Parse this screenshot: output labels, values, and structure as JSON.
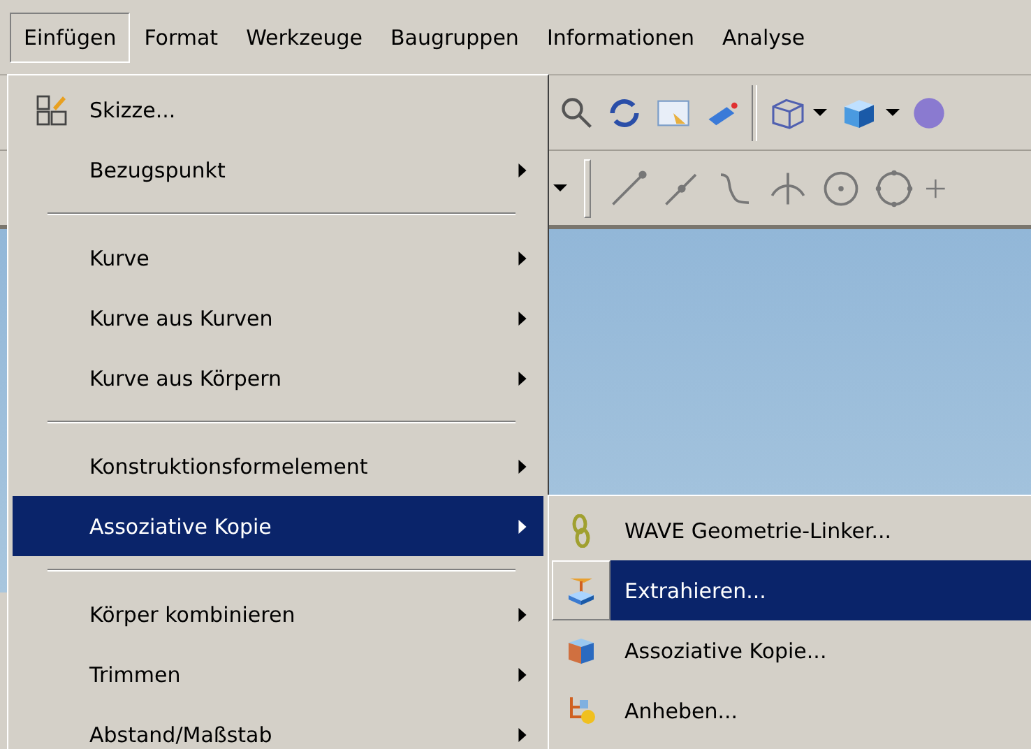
{
  "menu_bar": [
    {
      "label": "Einfügen",
      "selected": true
    },
    {
      "label": "Format",
      "selected": false
    },
    {
      "label": "Werkzeuge",
      "selected": false
    },
    {
      "label": "Baugruppen",
      "selected": false
    },
    {
      "label": "Informationen",
      "selected": false
    },
    {
      "label": "Analyse",
      "selected": false
    }
  ],
  "menu": {
    "items": [
      {
        "kind": "icon_item",
        "label": "Skizze...",
        "submenu": false,
        "selected": false
      },
      {
        "kind": "item",
        "label": "Bezugspunkt",
        "submenu": true,
        "selected": false
      },
      {
        "kind": "separator"
      },
      {
        "kind": "item",
        "label": "Kurve",
        "submenu": true,
        "selected": false
      },
      {
        "kind": "item",
        "label": "Kurve aus Kurven",
        "submenu": true,
        "selected": false
      },
      {
        "kind": "item",
        "label": "Kurve aus Körpern",
        "submenu": true,
        "selected": false
      },
      {
        "kind": "separator"
      },
      {
        "kind": "item",
        "label": "Konstruktionsformelement",
        "submenu": true,
        "selected": false
      },
      {
        "kind": "item",
        "label": "Assoziative Kopie",
        "submenu": true,
        "selected": true
      },
      {
        "kind": "separator"
      },
      {
        "kind": "item",
        "label": "Körper kombinieren",
        "submenu": true,
        "selected": false
      },
      {
        "kind": "item",
        "label": "Trimmen",
        "submenu": true,
        "selected": false
      },
      {
        "kind": "item",
        "label": "Abstand/Maßstab",
        "submenu": true,
        "selected": false
      }
    ]
  },
  "submenu": {
    "items": [
      {
        "label": "WAVE Geometrie-Linker...",
        "selected": false
      },
      {
        "label": "Extrahieren...",
        "selected": true
      },
      {
        "label": "Assoziative Kopie...",
        "selected": false
      },
      {
        "label": "Anheben...",
        "selected": false
      }
    ]
  }
}
